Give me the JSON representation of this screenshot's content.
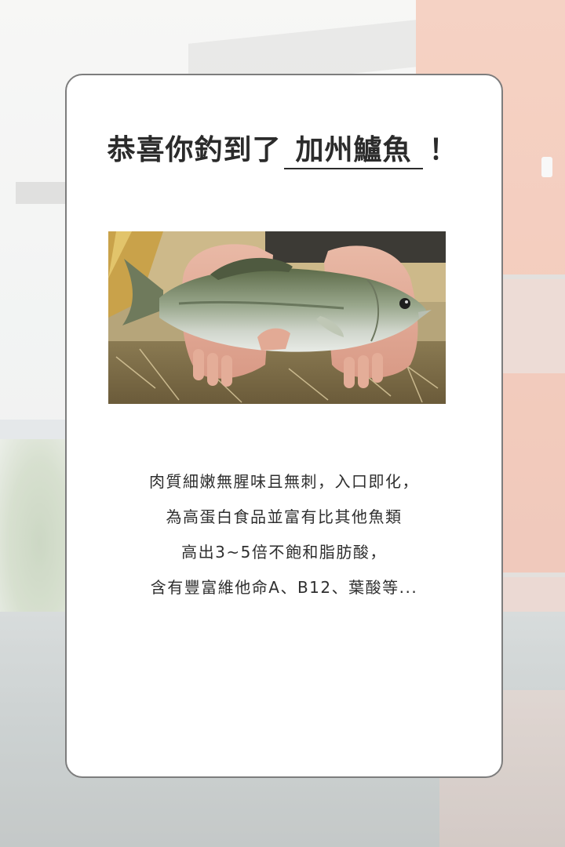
{
  "result": {
    "title_prefix": "恭喜你釣到了",
    "fish_name": "加州鱸魚",
    "title_suffix": "！"
  },
  "photo": {
    "subject": "largemouth bass held in two hands"
  },
  "description": {
    "lines": [
      "肉質細嫩無腥味且無刺，入口即化，",
      "為高蛋白食品並富有比其他魚類",
      "高出3~5倍不飽和脂肪酸，",
      "含有豐富維他命A、B12、葉酸等..."
    ]
  },
  "colors": {
    "card_background": "#ffffff",
    "card_border": "#7d7d7d",
    "title_text": "#2b2b2b",
    "body_text": "#2f2f2f"
  }
}
